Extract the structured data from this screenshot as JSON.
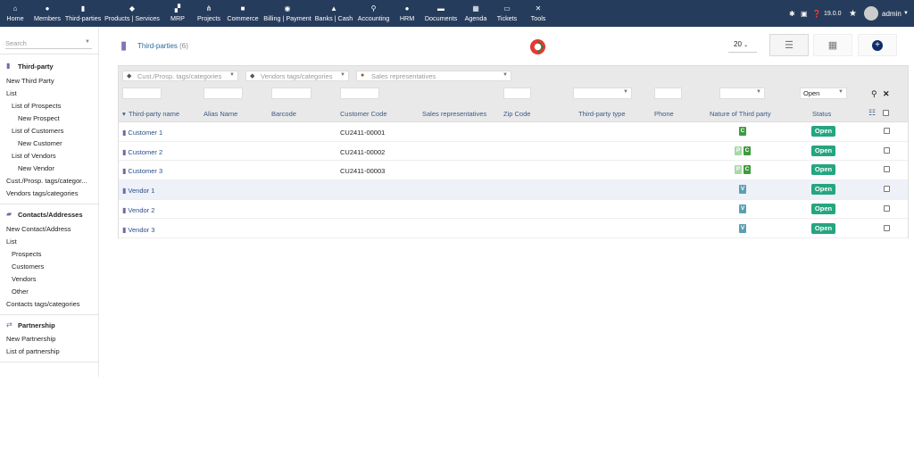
{
  "topnav": {
    "items": [
      {
        "label": "Home",
        "icon": "home-icon"
      },
      {
        "label": "Members",
        "icon": "members-icon"
      },
      {
        "label": "Third-parties",
        "icon": "building-icon"
      },
      {
        "label": "Products | Services",
        "icon": "cube-icon"
      },
      {
        "label": "MRP",
        "icon": "cubes-icon"
      },
      {
        "label": "Projects",
        "icon": "sitemap-icon"
      },
      {
        "label": "Commerce",
        "icon": "suitcase-icon"
      },
      {
        "label": "Billing | Payment",
        "icon": "coins-icon"
      },
      {
        "label": "Banks | Cash",
        "icon": "bank-icon"
      },
      {
        "label": "Accounting",
        "icon": "search-dollar-icon"
      },
      {
        "label": "HRM",
        "icon": "user-icon"
      },
      {
        "label": "Documents",
        "icon": "folder-icon"
      },
      {
        "label": "Agenda",
        "icon": "calendar-icon"
      },
      {
        "label": "Tickets",
        "icon": "ticket-icon"
      },
      {
        "label": "Tools",
        "icon": "tools-icon"
      }
    ],
    "version": "19.0.0",
    "user": "admin"
  },
  "sidebar": {
    "search_placeholder": "Search",
    "third_party": {
      "header": "Third-party",
      "items": [
        "New Third Party",
        "List",
        "List of Prospects",
        "New Prospect",
        "List of Customers",
        "New Customer",
        "List of Vendors",
        "New Vendor",
        "Cust./Prosp. tags/categor...",
        "Vendors tags/categories"
      ]
    },
    "contacts": {
      "header": "Contacts/Addresses",
      "items": [
        "New Contact/Address",
        "List",
        "Prospects",
        "Customers",
        "Vendors",
        "Other",
        "Contacts tags/categories"
      ]
    },
    "partnership": {
      "header": "Partnership",
      "items": [
        "New Partnership",
        "List of partnership"
      ]
    }
  },
  "main": {
    "title": "Third-parties",
    "count": "(6)",
    "limit": "20"
  },
  "filters": {
    "cust_tags_placeholder": "Cust./Prosp. tags/categories",
    "vendor_tags_placeholder": "Vendors tags/categories",
    "sales_rep_placeholder": "Sales representatives",
    "status_value": "Open"
  },
  "columns": [
    "Third-party name",
    "Alias Name",
    "Barcode",
    "Customer Code",
    "Sales representatives",
    "Zip Code",
    "Third-party type",
    "Phone",
    "Nature of Third party",
    "Status"
  ],
  "rows": [
    {
      "name": "Customer 1",
      "code": "CU2411-00001",
      "nature": [
        "C"
      ],
      "status": "Open"
    },
    {
      "name": "Customer 2",
      "code": "CU2411-00002",
      "nature": [
        "P",
        "C"
      ],
      "status": "Open"
    },
    {
      "name": "Customer 3",
      "code": "CU2411-00003",
      "nature": [
        "P",
        "C"
      ],
      "status": "Open"
    },
    {
      "name": "Vendor 1",
      "code": "",
      "nature": [
        "V"
      ],
      "status": "Open"
    },
    {
      "name": "Vendor 2",
      "code": "",
      "nature": [
        "V"
      ],
      "status": "Open"
    },
    {
      "name": "Vendor 3",
      "code": "",
      "nature": [
        "V"
      ],
      "status": "Open"
    }
  ],
  "colors": {
    "topbar": "#263c5c",
    "status_open": "#25a580",
    "customer_badge": "#3f9a3f",
    "prospect_badge": "#a9d8a9",
    "vendor_badge": "#5d9fb2"
  }
}
